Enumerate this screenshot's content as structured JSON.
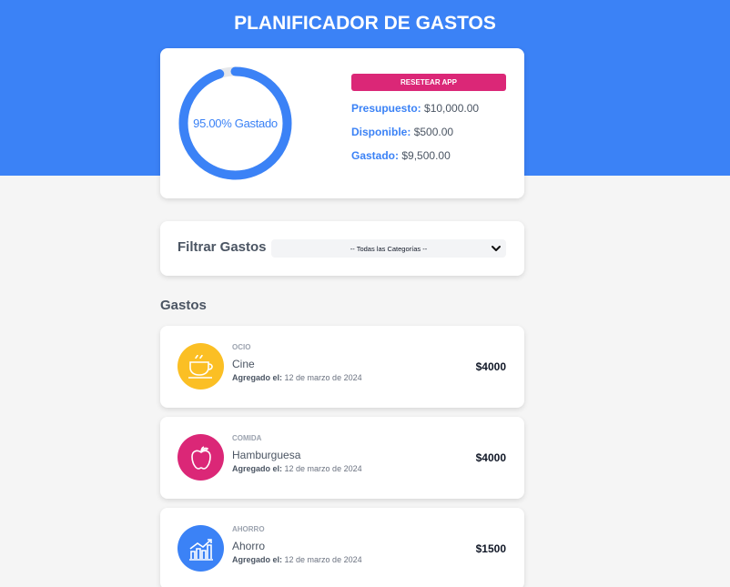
{
  "app": {
    "title": "PLANIFICADOR DE GASTOS"
  },
  "budget": {
    "progress_percent": 95,
    "progress_label": "95.00% Gastado",
    "reset_label": "RESETEAR APP",
    "presupuesto_label": "Presupuesto:",
    "presupuesto_value": "$10,000.00",
    "disponible_label": "Disponible:",
    "disponible_value": "$500.00",
    "gastado_label": "Gastado:",
    "gastado_value": "$9,500.00"
  },
  "filter": {
    "label": "Filtrar Gastos",
    "selected": "-- Todas las Categorías --"
  },
  "expenses_section": {
    "title": "Gastos"
  },
  "expenses": [
    {
      "category": "OCIO",
      "name": "Cine",
      "date_label": "Agregado el:",
      "date": "12 de marzo de 2024",
      "amount": "$4000",
      "icon": "coffee-cup-icon",
      "icon_color": "#fbbf24"
    },
    {
      "category": "COMIDA",
      "name": "Hamburguesa",
      "date_label": "Agregado el:",
      "date": "12 de marzo de 2024",
      "amount": "$4000",
      "icon": "apple-icon",
      "icon_color": "#db2777"
    },
    {
      "category": "AHORRO",
      "name": "Ahorro",
      "date_label": "Agregado el:",
      "date": "12 de marzo de 2024",
      "amount": "$1500",
      "icon": "savings-chart-icon",
      "icon_color": "#3b82f6"
    }
  ],
  "colors": {
    "primary": "#3b82f6",
    "accent": "#db2777",
    "background": "#f5f5f5"
  }
}
